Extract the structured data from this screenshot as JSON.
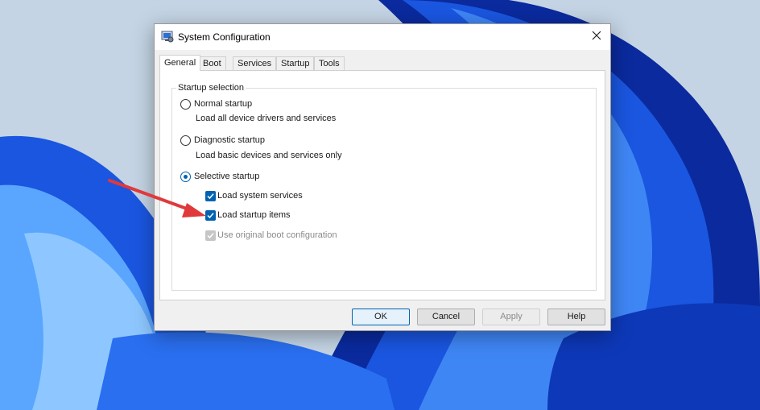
{
  "colors": {
    "accent": "#0063b1",
    "arrow": "#e0393b",
    "wallpaper_bg": "#c4d4e4",
    "bloom_dark": "#0a2a9e",
    "bloom_mid": "#1a56e0",
    "bloom_light": "#5aa6ff"
  },
  "window": {
    "title": "System Configuration",
    "icon": "msconfig-icon",
    "close_icon": "close-icon"
  },
  "tabs": [
    {
      "label": "General",
      "active": true
    },
    {
      "label": "Boot",
      "active": false
    },
    {
      "label": "Services",
      "active": false
    },
    {
      "label": "Startup",
      "active": false
    },
    {
      "label": "Tools",
      "active": false
    }
  ],
  "general": {
    "group_label": "Startup selection",
    "normal": {
      "label": "Normal startup",
      "description": "Load all device drivers and services",
      "selected": false
    },
    "diagnostic": {
      "label": "Diagnostic startup",
      "description": "Load basic devices and services only",
      "selected": false
    },
    "selective": {
      "label": "Selective startup",
      "selected": true
    },
    "options": [
      {
        "label": "Load system services",
        "checked": true,
        "enabled": true
      },
      {
        "label": "Load startup items",
        "checked": true,
        "enabled": true
      },
      {
        "label": "Use original boot configuration",
        "checked": true,
        "enabled": false
      }
    ]
  },
  "buttons": {
    "ok": "OK",
    "cancel": "Cancel",
    "apply": "Apply",
    "help": "Help"
  }
}
